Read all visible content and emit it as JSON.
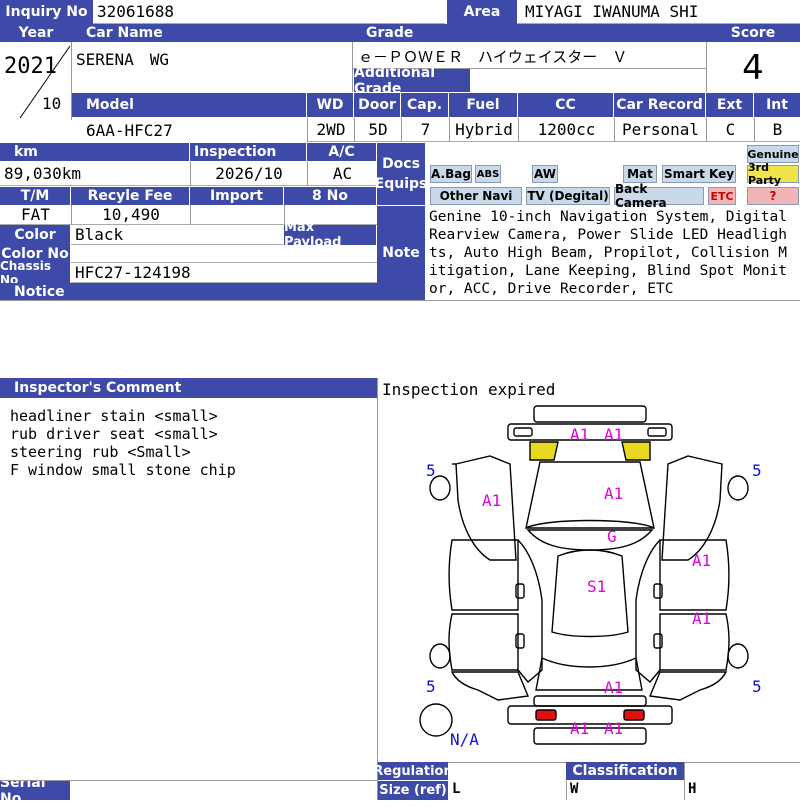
{
  "header": {
    "inquiry_label": "Inquiry No",
    "inquiry_value": "32061688",
    "area_label": "Area",
    "area_value": "MIYAGI IWANUMA SHI"
  },
  "row1": {
    "year_label": "Year",
    "car_name_label": "Car Name",
    "grade_label": "Grade",
    "score_label": "Score",
    "year": "2021",
    "month": "10",
    "car_name": "SERENA　WG",
    "grade": "ｅ－ＰＯＷＥＲ　ハイウェイスター　Ｖ",
    "additional_grade_label": "Additional Grade",
    "additional_grade": "",
    "score": "4"
  },
  "row2": {
    "model_label": "Model",
    "wd_label": "WD",
    "door_label": "Door",
    "cap_label": "Cap.",
    "fuel_label": "Fuel",
    "cc_label": "CC",
    "car_record_label": "Car Record",
    "ext_label": "Ext",
    "int_label": "Int",
    "model": "6AA-HFC27",
    "wd": "2WD",
    "door": "5D",
    "cap": "7",
    "fuel": "Hybrid",
    "cc": "1200cc",
    "car_record": "Personal",
    "ext": "C",
    "int": "B"
  },
  "row3": {
    "km_label": "km",
    "inspection_label": "Inspection",
    "ac_label": "A/C",
    "km": "89,030km",
    "inspection": "2026/10",
    "ac": "AC",
    "tm_label": "T/M",
    "recycle_fee_label": "Recyle Fee",
    "import_label": "Import",
    "no8_label": "8 No",
    "tm": "FAT",
    "recycle_fee": "10,490",
    "import": "",
    "color_label": "Color",
    "color": "Black",
    "max_payload_label": "Max Payload",
    "color_no_label": "Color No",
    "chassis_label": "Chassis No",
    "chassis": "HFC27-124198",
    "notice_label": "Notice"
  },
  "docs": {
    "label_line1": "Docs",
    "label_line2": "Equips",
    "badges": [
      "A.Bag",
      "ABS",
      "AW",
      "Mat",
      "Smart Key",
      "Genuine",
      "3rd Party",
      "Other Navi",
      "TV (Degital)",
      "Back Camera",
      "ETC",
      "?"
    ]
  },
  "note": {
    "label": "Note",
    "text": "Genine 10-inch Navigation System, Digital Rearview Camera, Power Slide LED Headlights, Auto High Beam, Propilot, Collision Mitigation, Lane Keeping, Blind Spot Monitor, ACC, Drive Recorder, ETC"
  },
  "inspector": {
    "label": "Inspector's Comment",
    "lines": [
      "headliner stain <small>",
      "rub driver seat <small>",
      "steering rub <Small>",
      "F window small stone chip"
    ]
  },
  "diagram": {
    "status": "Inspection expired",
    "marks": [
      "A1",
      "A1",
      "A1",
      "A1",
      "G",
      "A1",
      "S1",
      "A1",
      "A1",
      "A1",
      "A1"
    ],
    "tire_depths": [
      "5",
      "5",
      "5",
      "5"
    ],
    "spare": "N/A"
  },
  "footer": {
    "serial_label": "Serial No",
    "regulation_label": "Regulation",
    "size_label": "Size (ref)",
    "classification_label": "Classification",
    "l_label": "L",
    "w_label": "W",
    "h_label": "H"
  },
  "colors": {
    "header_bg": "#3d4aa8",
    "damage_yellow": "#e8d820",
    "damage_red": "#e01010",
    "mark_magenta": "#e000e0",
    "tire_blue": "#1010d0"
  }
}
